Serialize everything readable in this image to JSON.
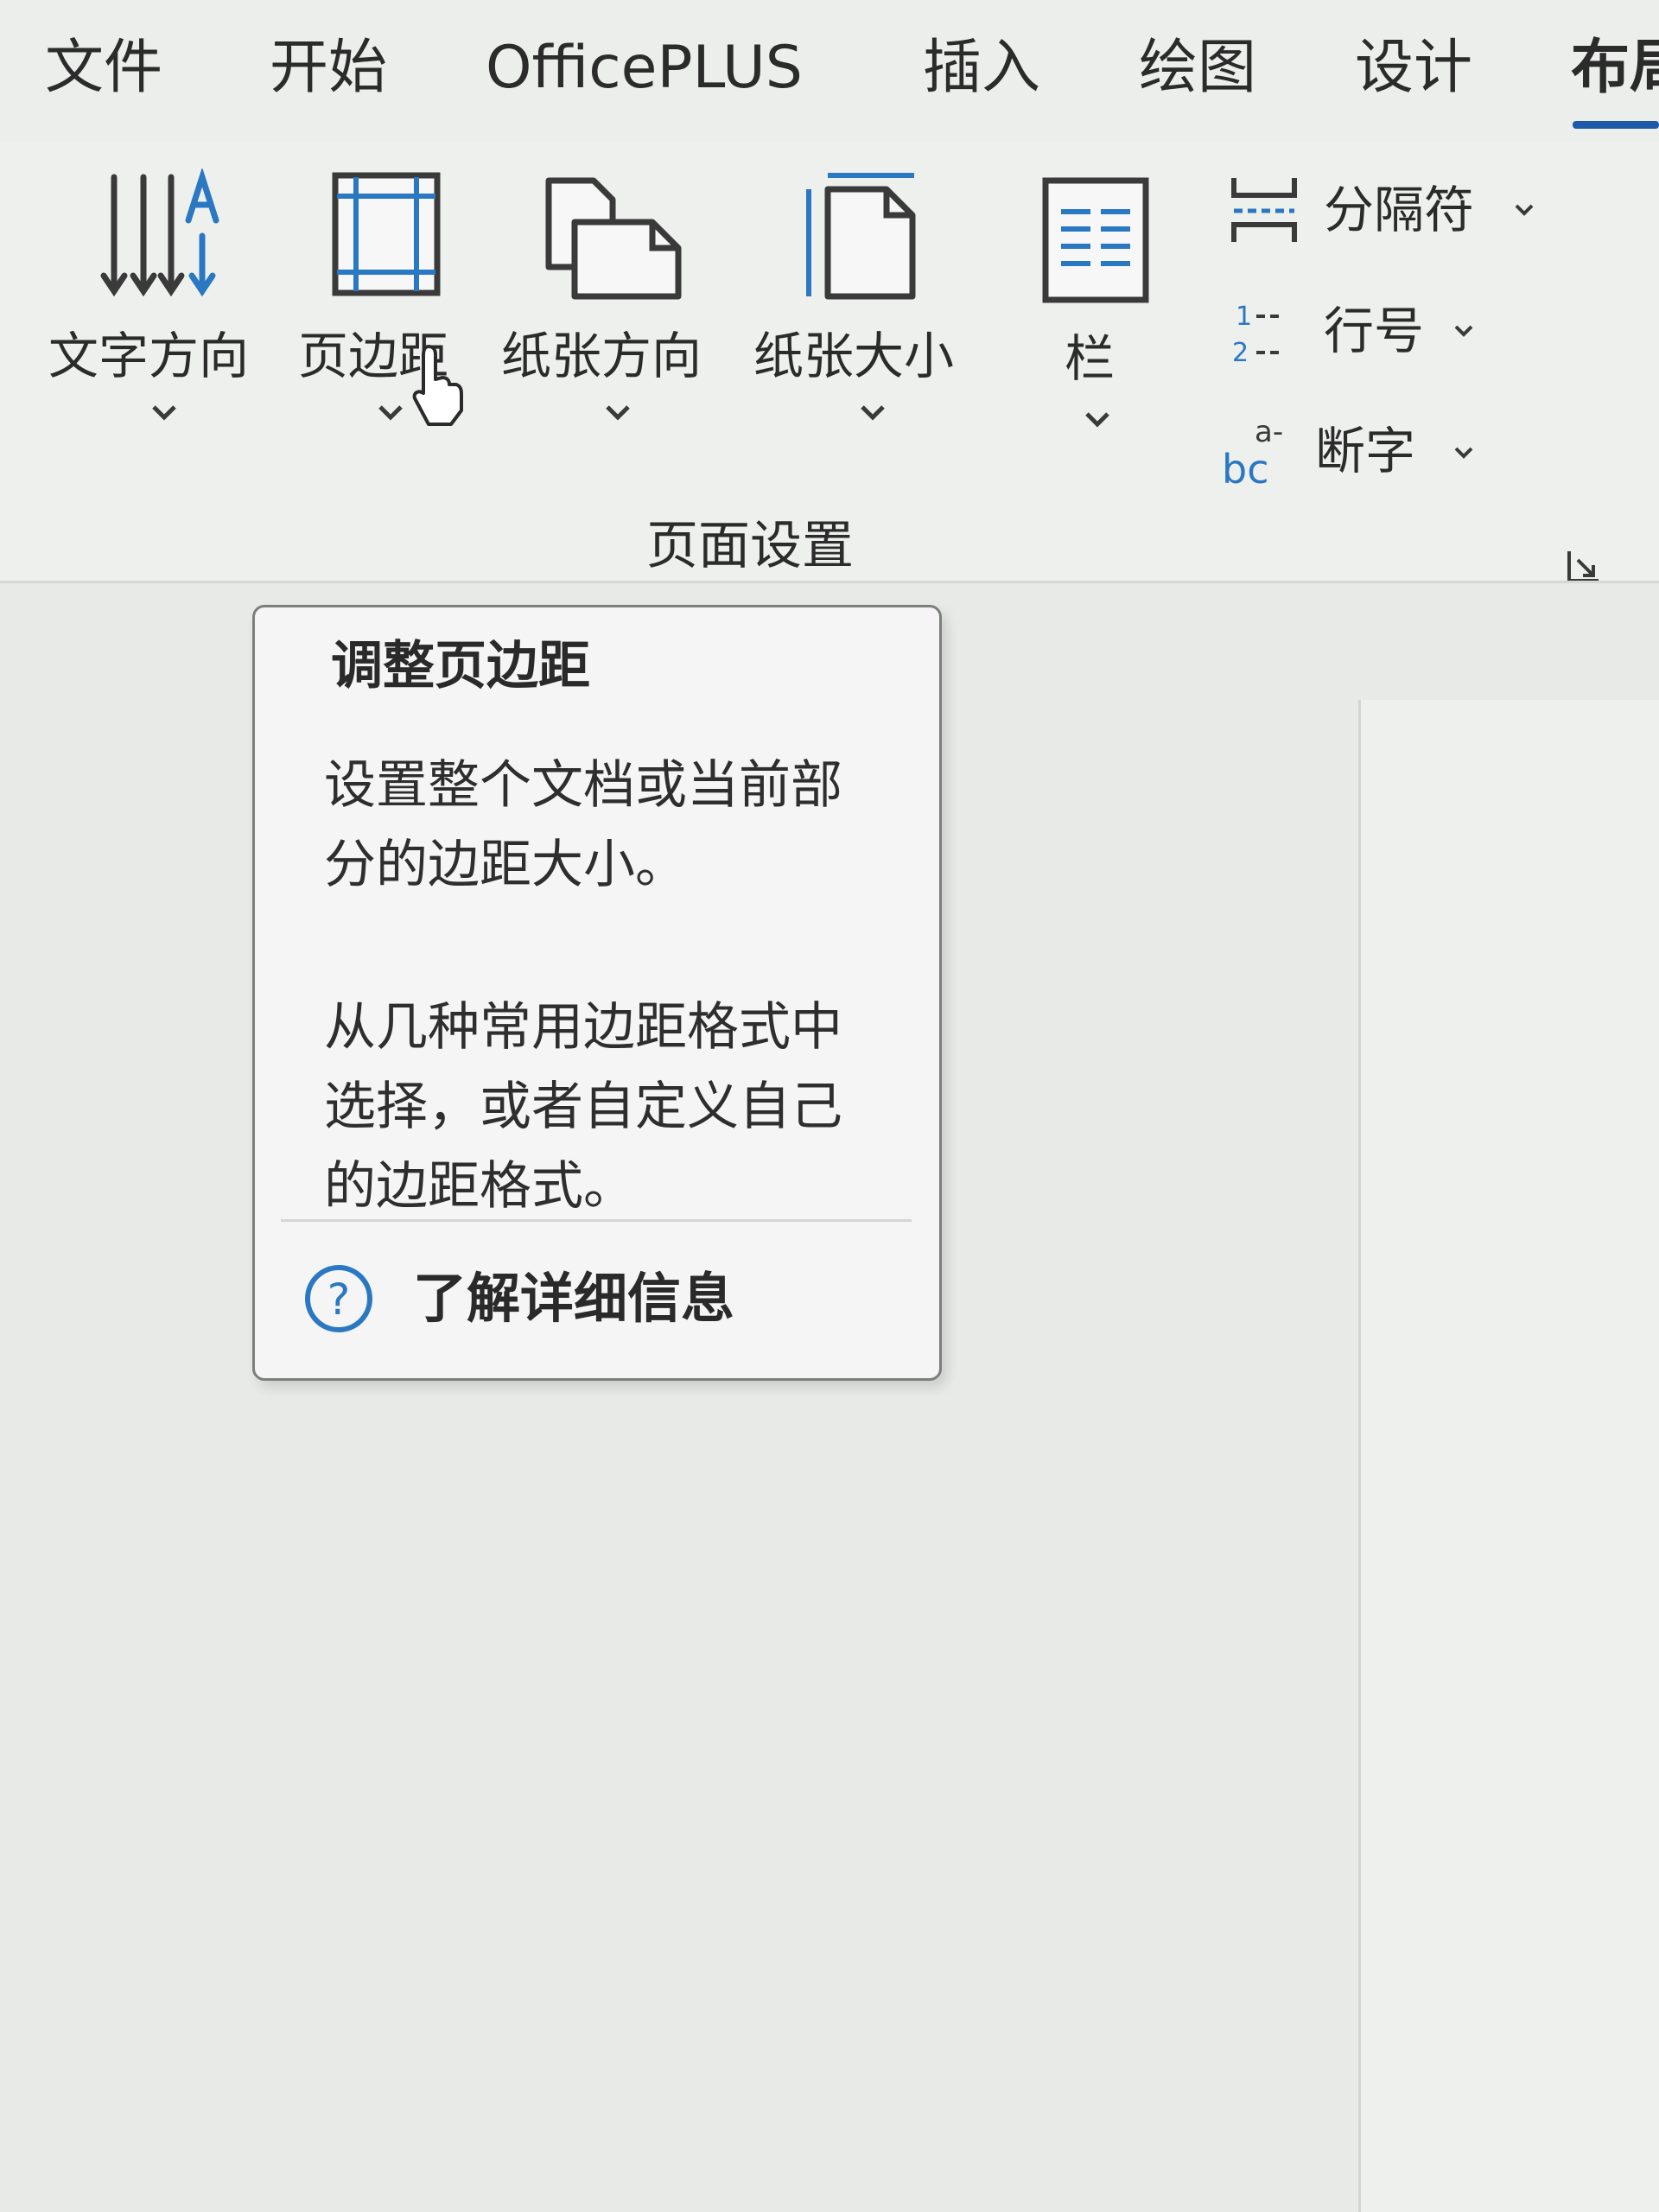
{
  "tabs": [
    {
      "label": "文件"
    },
    {
      "label": "开始"
    },
    {
      "label": "OfficePLUS"
    },
    {
      "label": "插入"
    },
    {
      "label": "绘图"
    },
    {
      "label": "设计"
    },
    {
      "label": "布局"
    }
  ],
  "ribbon": {
    "group_label": "页面设置",
    "buttons": [
      {
        "label": "文字方向",
        "icon": "text-direction-icon"
      },
      {
        "label": "页边距",
        "icon": "margins-icon"
      },
      {
        "label": "纸张方向",
        "icon": "orientation-icon"
      },
      {
        "label": "纸张大小",
        "icon": "paper-size-icon"
      },
      {
        "label": "栏",
        "icon": "columns-icon"
      }
    ],
    "small_buttons": [
      {
        "label": "分隔符",
        "icon": "breaks-icon"
      },
      {
        "label": "行号",
        "icon": "line-numbers-icon"
      },
      {
        "label": "断字",
        "icon": "hyphenation-icon"
      }
    ],
    "line_numbers_icon_text": [
      "1",
      "2"
    ],
    "hyphenation_icon_text": "bc",
    "hyphenation_icon_superscript": "a-"
  },
  "tooltip": {
    "title": "调整页边距",
    "paragraph1": "设置整个文档或当前部\n分的边距大小。",
    "paragraph2": "从几种常用边距格式中\n选择，或者自定义自己\n的边距格式。",
    "help_link": "了解详细信息",
    "help_icon_text": "?"
  },
  "colors": {
    "accent": "#1e5aa8",
    "icon_blue": "#2b78c2"
  }
}
